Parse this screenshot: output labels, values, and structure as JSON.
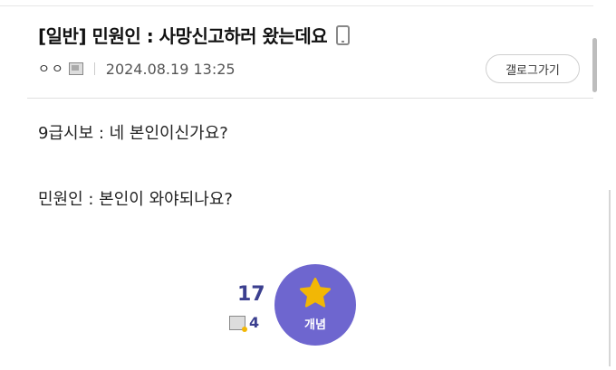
{
  "post": {
    "title": "[일반] 민원인 : 사망신고하러 왔는데요",
    "author": "ㅇㅇ",
    "date": "2024.08.19 13:25",
    "gallery_button": "갤로그가기",
    "lines": [
      "9급시보 : 네 본인이신가요?",
      "민원인 : 본인이 와야되나요?"
    ]
  },
  "recommend": {
    "count": "17",
    "fixed_count": "4",
    "button_label": "개념"
  },
  "colors": {
    "accent": "#6e66cf",
    "count_text": "#3b3f8f",
    "star": "#f2b705"
  },
  "icons": [
    "phone-icon",
    "fixed-nick-icon",
    "star-icon"
  ]
}
